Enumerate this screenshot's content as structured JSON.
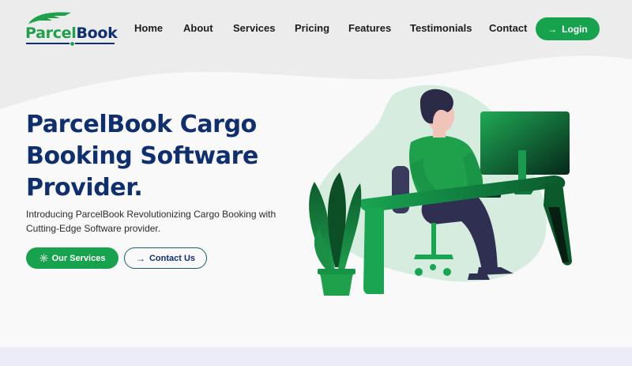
{
  "brand": {
    "logo_part1": "Parcel",
    "logo_part2": "Book",
    "colors": {
      "green": "#17a24d",
      "navy": "#0f2f6e"
    }
  },
  "nav": {
    "items": [
      "Home",
      "About",
      "Services",
      "Pricing",
      "Features",
      "Testimonials",
      "Contact"
    ],
    "login_label": "Login",
    "login_icon": "arrow-right-icon"
  },
  "hero": {
    "title": "ParcelBook Cargo Booking Software Provider.",
    "description": "Introducing ParcelBook Revolutionizing Cargo Booking with Cutting-Edge Software provider.",
    "primary_button": {
      "label": "Our Services",
      "icon": "gear-icon"
    },
    "secondary_button": {
      "label": "Contact Us",
      "icon": "arrow-right-icon"
    }
  }
}
